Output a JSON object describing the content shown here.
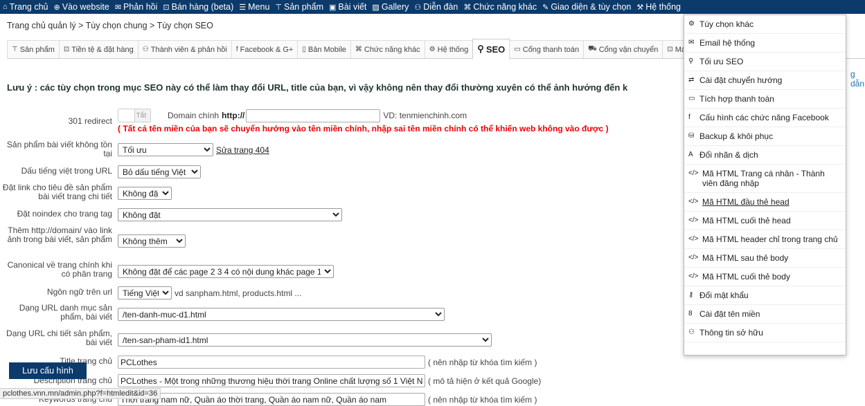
{
  "topnav": [
    {
      "icon": "home-icon",
      "glyph": "⌂",
      "label": "Trang chủ"
    },
    {
      "icon": "globe-icon",
      "glyph": "⊕",
      "label": "Vào website"
    },
    {
      "icon": "mail-icon",
      "glyph": "✉",
      "label": "Phản hồi"
    },
    {
      "icon": "cart-icon",
      "glyph": "⊡",
      "label": "Bán hàng (beta)"
    },
    {
      "icon": "menu-icon",
      "glyph": "☰",
      "label": "Menu"
    },
    {
      "icon": "shirt-icon",
      "glyph": "⊤",
      "label": "Sản phẩm"
    },
    {
      "icon": "article-icon",
      "glyph": "▣",
      "label": "Bài viết"
    },
    {
      "icon": "gallery-icon",
      "glyph": "▨",
      "label": "Gallery"
    },
    {
      "icon": "users-icon",
      "glyph": "⚇",
      "label": "Diễn đàn"
    },
    {
      "icon": "puzzle-icon",
      "glyph": "⌘",
      "label": "Chức năng khác"
    },
    {
      "icon": "brush-icon",
      "glyph": "✎",
      "label": "Giao diện & tùy chọn"
    },
    {
      "icon": "wrench-icon",
      "glyph": "⚒",
      "label": "Hệ thống"
    }
  ],
  "breadcrumb": "Trang chủ quản lý > Tùy chọn chung > Tùy chọn SEO",
  "tabs": [
    {
      "icon": "shirt-icon",
      "glyph": "⊤",
      "label": "Sản phẩm"
    },
    {
      "icon": "cart-icon",
      "glyph": "⊡",
      "label": "Tiền tệ & đặt hàng"
    },
    {
      "icon": "users-icon",
      "glyph": "⚇",
      "label": "Thành viên & phản hồi"
    },
    {
      "icon": "facebook-icon",
      "glyph": "f",
      "label": "Facebook & G+"
    },
    {
      "icon": "mobile-icon",
      "glyph": "▯",
      "label": "Bản Mobile"
    },
    {
      "icon": "puzzle-icon",
      "glyph": "⌘",
      "label": "Chức năng khác"
    },
    {
      "icon": "gear-icon",
      "glyph": "⚙",
      "label": "Hệ thống"
    },
    {
      "icon": "search-icon",
      "glyph": "⚲",
      "label": "SEO"
    },
    {
      "icon": "card-icon",
      "glyph": "▭",
      "label": "Cổng thanh toán"
    },
    {
      "icon": "truck-icon",
      "glyph": "⛟",
      "label": "Cổng vận chuyển"
    },
    {
      "icon": "cart-icon",
      "glyph": "⊡",
      "label": "Máy bá"
    }
  ],
  "note": "Lưu ý : các tùy chọn trong mục SEO này có thể làm thay đổi URL, title của bạn, vì vậy không nên thay đổi thường xuyên có thể ảnh hưởng đến k",
  "side_hint": "g dẫn",
  "form": {
    "redirect": {
      "label": "301 redirect",
      "toggle": "Tắt",
      "domain_label": "Domain chính",
      "prefix": "http://",
      "domain_value": "",
      "example": "VD: tenmienchinh.com",
      "warning": "( Tất cả tên miền của bạn sẽ chuyển hướng vào tên miền chính, nhập sai tên miền chính có thể khiến web không vào được )"
    },
    "notfound": {
      "label": "Sản phẩm bài viết không tồn tại",
      "value": "Tối ưu",
      "link": "Sửa trang 404"
    },
    "accent": {
      "label": "Dấu tiếng việt trong URL",
      "value": "Bỏ dấu tiếng Việt"
    },
    "titlelink": {
      "label": "Đặt link cho tiêu đề sản phẩm bài viết trang chi tiết",
      "value": "Không đặt"
    },
    "noindex": {
      "label": "Đặt noindex cho trang tag",
      "value": "Không đặt"
    },
    "domainimg": {
      "label": "Thêm http://domain/ vào link ảnh trong bài viết, sản phẩm",
      "value": "Không thêm"
    },
    "canonical": {
      "label": "Canonical về trang chính khi có phân trang",
      "value": "Không đặt để các page 2 3 4 có nội dung khác page 1"
    },
    "lang": {
      "label": "Ngôn ngữ trên url",
      "value": "Tiếng Việt",
      "hint": "vd sanpham.html, products.html ..."
    },
    "caturl": {
      "label": "Dạng URL danh mục sản phẩm, bài viết",
      "value": "/ten-danh-muc-d1.html"
    },
    "detailurl": {
      "label": "Dạng URL chi tiết sản phẩm, bài viết",
      "value": "/ten-san-pham-id1.html"
    },
    "title": {
      "label": "Title trang chủ",
      "value": "PCLothes",
      "hint": "( nên nhập từ khóa tìm kiếm )"
    },
    "desc": {
      "label": "Description trang chủ",
      "value": "PCLothes - Một trong những thương hiệu thời trang Online chất lượng số 1 Việt N",
      "hint": "( mô tả hiện ở kết quả Google)"
    },
    "keywords": {
      "label": "Keywords trang chủ",
      "value": "Thời trang nam nữ, Quần áo thời trang, Quần áo nam nữ, Quần áo nam",
      "hint": "( nên nhập từ khóa tìm kiếm )"
    }
  },
  "save_button": "Lưu cấu hình",
  "status_url": "pclothes.vnn.mn/admin.php?f=htmledit&id=36",
  "dropdown": [
    {
      "icon": "gear-icon",
      "glyph": "⚙",
      "label": "Tùy chọn khác"
    },
    {
      "icon": "mail-icon",
      "glyph": "✉",
      "label": "Email hệ thống"
    },
    {
      "icon": "search-icon",
      "glyph": "⚲",
      "label": "Tối ưu SEO"
    },
    {
      "icon": "redirect-icon",
      "glyph": "⇄",
      "label": "Cài đặt chuyển hướng"
    },
    {
      "icon": "card-icon",
      "glyph": "▭",
      "label": "Tích hợp thanh toán"
    },
    {
      "icon": "facebook-icon",
      "glyph": "f",
      "label": "Cấu hình các chức năng Facebook"
    },
    {
      "icon": "drive-icon",
      "glyph": "⛁",
      "label": "Backup & khôi phục"
    },
    {
      "icon": "translate-icon",
      "glyph": "A",
      "label": "Đổi nhãn & dịch"
    },
    {
      "icon": "code-icon",
      "glyph": "</>",
      "label": "Mã HTML Trang cá nhân - Thành viên đăng nhập"
    },
    {
      "icon": "code-icon",
      "glyph": "</>",
      "label": "Mã HTML đầu thẻ head"
    },
    {
      "icon": "code-icon",
      "glyph": "</>",
      "label": "Mã HTML cuối thẻ head"
    },
    {
      "icon": "code-icon",
      "glyph": "</>",
      "label": "Mã HTML header chỉ trong trang chủ"
    },
    {
      "icon": "code-icon",
      "glyph": "</>",
      "label": "Mã HTML sau thẻ body"
    },
    {
      "icon": "code-icon",
      "glyph": "</>",
      "label": "Mã HTML cuối thẻ body"
    },
    {
      "icon": "key-icon",
      "glyph": "⚷",
      "label": "Đổi mật khẩu"
    },
    {
      "icon": "domain-icon",
      "glyph": "8",
      "label": "Cài đặt tên miền"
    },
    {
      "icon": "user-icon",
      "glyph": "⚇",
      "label": "Thông tin sở hữu"
    }
  ]
}
